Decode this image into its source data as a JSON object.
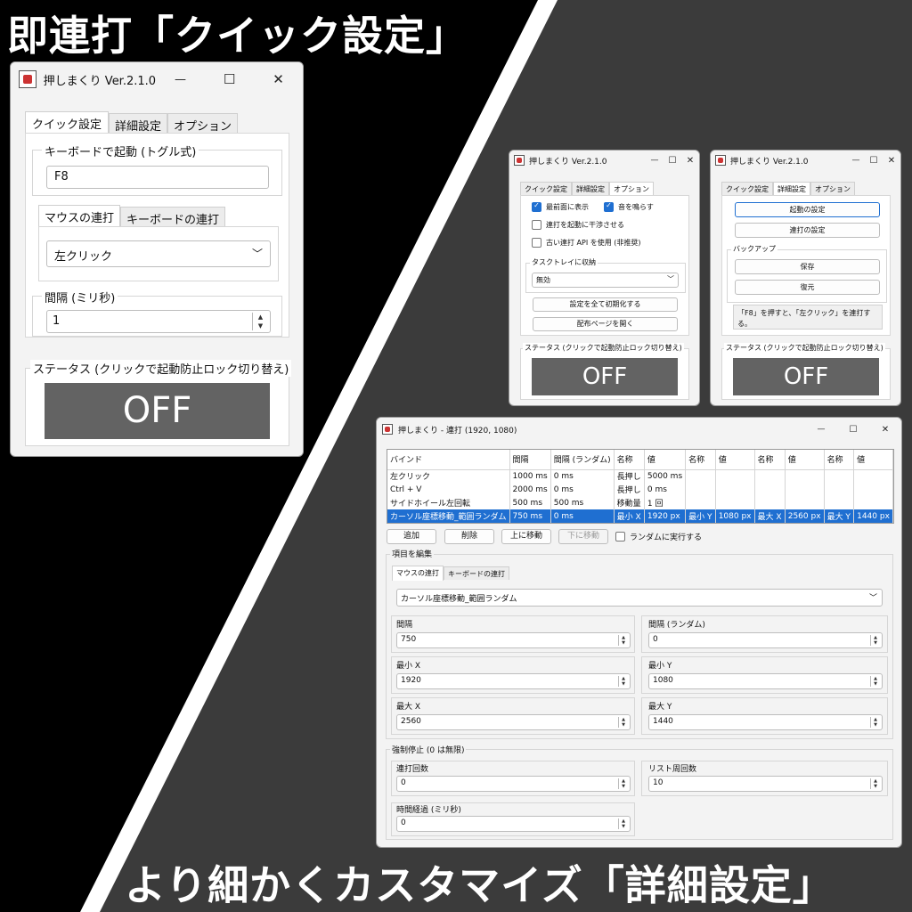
{
  "banner_top": "即連打「クイック設定」",
  "banner_bottom": "より細かくカスタマイズ「詳細設定」",
  "app": {
    "title": "押しまくり Ver.2.1.0",
    "minimize": "—",
    "maximize": "☐",
    "close": "✕"
  },
  "tabs": {
    "quick": "クイック設定",
    "detail": "詳細設定",
    "options": "オプション"
  },
  "quick": {
    "keyboard_group": "キーボードで起動 (トグル式)",
    "hotkey_value": "F8",
    "subtab_mouse": "マウスの連打",
    "subtab_keyboard": "キーボードの連打",
    "click_select": "左クリック",
    "interval_group": "間隔 (ミリ秒)",
    "interval_value": "1",
    "status_group": "ステータス (クリックで起動防止ロック切り替え)",
    "status_value": "OFF"
  },
  "options": {
    "topmost": "最前面に表示",
    "sound": "音を鳴らす",
    "interfere": "連打を起動に干渉させる",
    "old_api": "古い連打 API を使用 (非推奨)",
    "tray_group": "タスクトレイに収納",
    "tray_value": "無効",
    "reset_button": "設定を全て初期化する",
    "open_page_button": "配布ページを開く",
    "status_group": "ステータス (クリックで起動防止ロック切り替え)",
    "status_value": "OFF"
  },
  "detail": {
    "launch_settings": "起動の設定",
    "rapid_settings": "連打の設定",
    "backup_group": "バックアップ",
    "save": "保存",
    "restore": "復元",
    "hint": "「F8」を押すと、「左クリック」を連打する。",
    "status_group": "ステータス (クリックで起動防止ロック切り替え)",
    "status_value": "OFF"
  },
  "rapid": {
    "title": "押しまくり - 連打 (1920, 1080)",
    "columns": [
      "バインド",
      "間隔",
      "間隔 (ランダム)",
      "名称",
      "値",
      "名称",
      "値",
      "名称",
      "値",
      "名称",
      "値"
    ],
    "rows": [
      [
        "左クリック",
        "1000 ms",
        "0 ms",
        "長押し",
        "5000 ms",
        "",
        "",
        "",
        "",
        "",
        ""
      ],
      [
        "Ctrl + V",
        "2000 ms",
        "0 ms",
        "長押し",
        "0 ms",
        "",
        "",
        "",
        "",
        "",
        ""
      ],
      [
        "サイドホイール左回転",
        "500 ms",
        "500 ms",
        "移動量",
        "1 回",
        "",
        "",
        "",
        "",
        "",
        ""
      ],
      [
        "カーソル座標移動_範囲ランダム",
        "750 ms",
        "0 ms",
        "最小 X",
        "1920 px",
        "最小 Y",
        "1080 px",
        "最大 X",
        "2560 px",
        "最大 Y",
        "1440 px"
      ]
    ],
    "add": "追加",
    "delete": "削除",
    "move_up": "上に移動",
    "move_down": "下に移動",
    "random_exec": "ランダムに実行する",
    "edit_group": "項目を編集",
    "subtab_mouse": "マウスの連打",
    "subtab_keyboard": "キーボードの連打",
    "action_select": "カーソル座標移動_範囲ランダム",
    "interval_label": "間隔",
    "interval_value": "750",
    "interval_random_label": "間隔 (ランダム)",
    "interval_random_value": "0",
    "min_x_label": "最小 X",
    "min_x_value": "1920",
    "min_y_label": "最小 Y",
    "min_y_value": "1080",
    "max_x_label": "最大 X",
    "max_x_value": "2560",
    "max_y_label": "最大 Y",
    "max_y_value": "1440",
    "force_stop_group": "強制停止 (0 は無限)",
    "count_label": "連打回数",
    "count_value": "0",
    "loop_label": "リスト周回数",
    "loop_value": "10",
    "elapsed_label": "時間経過 (ミリ秒)",
    "elapsed_value": "0"
  }
}
